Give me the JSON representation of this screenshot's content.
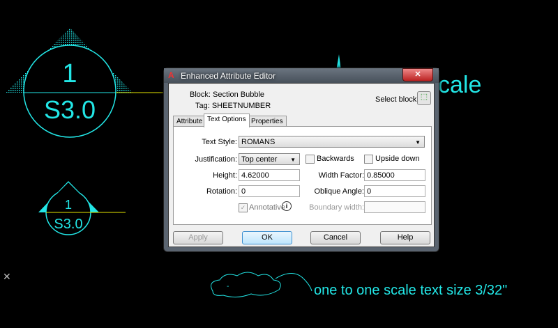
{
  "drawing": {
    "bubble_large": {
      "number": "1",
      "sheet": "S3.0"
    },
    "bubble_small": {
      "number": "1",
      "sheet": "S3.0"
    },
    "partial_text": "cale",
    "note": "one to one scale text size 3/32\"",
    "cloud_text": "-",
    "ucs_mark": "✕"
  },
  "dialog": {
    "title": "Enhanced Attribute Editor",
    "app_icon": "autocad-lt-icon",
    "close": "✕",
    "block_label": "Block: Section Bubble",
    "tag_label": "Tag: SHEETNUMBER",
    "select_block": "Select block",
    "tabs": [
      "Attribute",
      "Text Options",
      "Properties"
    ],
    "active_tab": "Text Options",
    "text_style_label": "Text Style:",
    "text_style": "ROMANS",
    "justification_label": "Justification:",
    "justification": "Top center",
    "backwards": "Backwards",
    "upside_down": "Upside down",
    "height_label": "Height:",
    "height": "4.62000",
    "width_factor_label": "Width Factor:",
    "width_factor": "0.85000",
    "rotation_label": "Rotation:",
    "rotation": "0",
    "oblique_label": "Oblique Angle:",
    "oblique": "0",
    "annotative": "Annotative",
    "boundary_label": "Boundary width:",
    "boundary": "",
    "buttons": {
      "apply": "Apply",
      "ok": "OK",
      "cancel": "Cancel",
      "help": "Help"
    }
  },
  "colors": {
    "cad_cyan": "#22e6e6",
    "cad_yellow": "#e6e600"
  }
}
